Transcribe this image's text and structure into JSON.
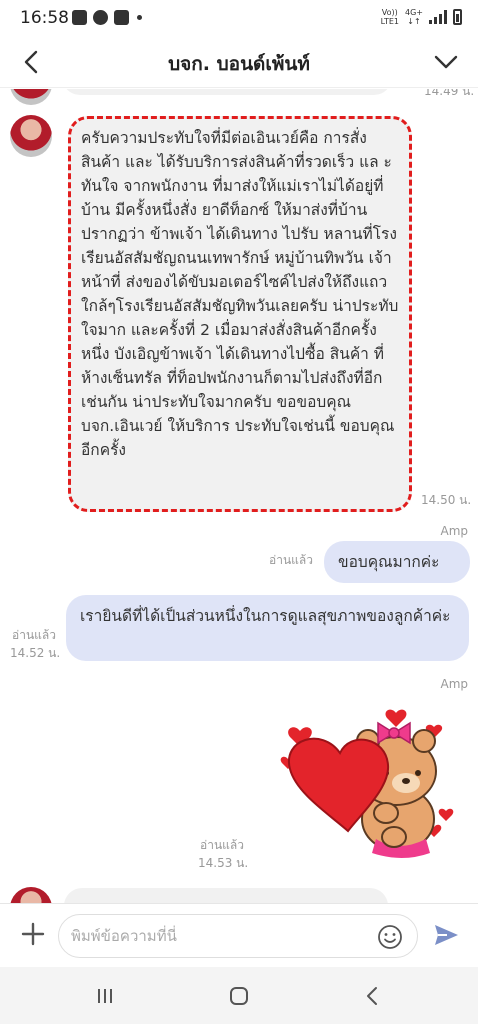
{
  "status_bar": {
    "time": "16:58",
    "network_top": "Vo))",
    "network_bottom": "LTE1",
    "data_top": "4G+",
    "data_bottom": "↓↑"
  },
  "header": {
    "title": "บจก. บอนด์เพ้นท์",
    "back_icon": "chevron-left-icon",
    "menu_icon": "chevron-down-icon"
  },
  "messages": {
    "incoming_1": {
      "text": "ครับความประทับใจที่มีต่อเอินเวย์คือ การสั่งสินค้า และ ได้รับบริการส่งสินค้าที่รวดเร็ว แล ะทันใจ จากพนักงาน ที่มาส่งให้แม่เราไม่ได้อยู่ที่บ้าน มีครั้งหนึ่งสั่ง ยาดีท็อกซ์ ให้มาส่งที่บ้าน ปรากฏว่า ข้าพเจ้า ได้เดินทาง ไปรับ หลานที่โรงเรียนอัสสัมชัญถนนเทพารักษ์ หมู่บ้านทิพวัน เจ้าหน้าที่ ส่งของได้ขับมอเตอร์ไซค์ไปส่งให้ถึงแถวใกล้ๆโรงเรียนอัสสัมชัญทิพวันเลยครับ น่าประทับใจมาก และครั้งที่ 2 เมื่อมาส่งสั่งสินค้าอีกครั้งหนึ่ง บังเอิญข้าพเจ้า ได้เดินทางไปซื้อ สินค้า ที่ ห้างเซ็นทรัล ที่ท็อปพนักงานก็ตามไปส่งถึงที่อีกเช่นกัน น่าประทับใจมากครับ ขอขอบคุณ บจก.เอินเวย์  ให้บริการ ประทับใจเช่นนี้ ขอบคุณอีกครั้ง",
      "time": "14.50 น."
    },
    "outgoing_1": {
      "sender": "Amp",
      "text": "ขอบคุณมากค่ะ",
      "read": "อ่านแล้ว"
    },
    "outgoing_2": {
      "text": "เรายินดีที่ได้เป็นส่วนหนึ่งในการดูแลสุขภาพของลูกค้าค่ะ",
      "read": "อ่านแล้ว",
      "time": "14.52 น."
    },
    "outgoing_3": {
      "sender": "Amp",
      "sticker": "bear-hugging-heart-sticker",
      "read": "อ่านแล้ว",
      "time": "14.53 น."
    },
    "top_partial_time": "14.49 น."
  },
  "composer": {
    "placeholder": "พิมพ์ข้อความที่นี่",
    "plus_icon": "plus-icon",
    "emoji_icon": "emoji-icon",
    "send_icon": "send-icon"
  },
  "navbar": {
    "recent_icon": "recent-apps-icon",
    "home_icon": "home-icon",
    "back_icon": "back-icon"
  },
  "colors": {
    "incoming_bubble": "#f1f1f1",
    "outgoing_bubble": "#dfe4f7",
    "highlight_border": "#e11d1d",
    "send_icon": "#7b8fc7"
  }
}
